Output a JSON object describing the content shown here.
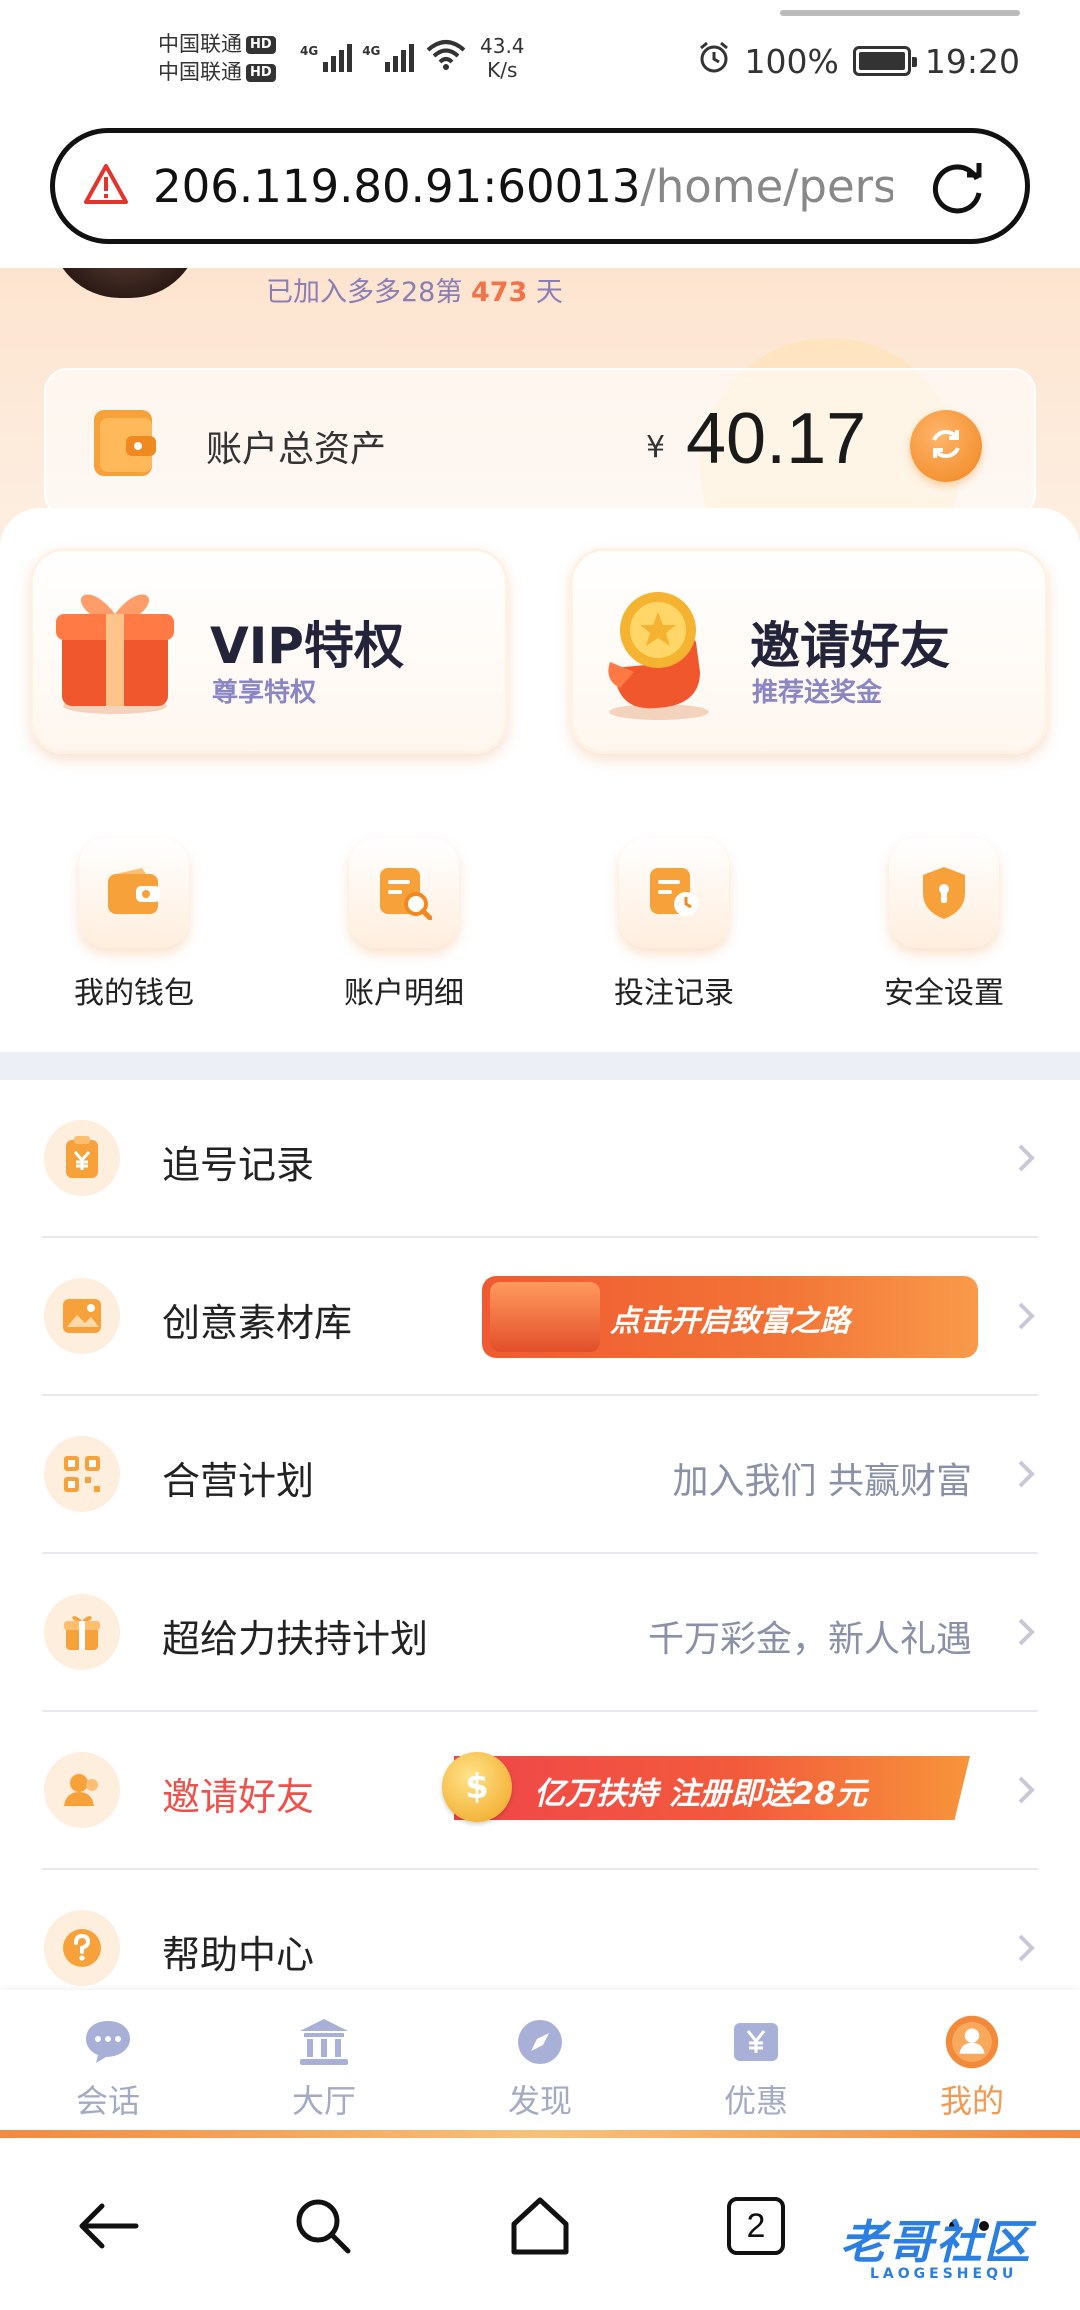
{
  "status_bar": {
    "carrier_1": "中国联通",
    "carrier_2": "中国联通",
    "hd_label": "HD",
    "network_1": "4G",
    "network_2": "4G",
    "speed_value": "43.4",
    "speed_unit": "K/s",
    "battery": "100%",
    "time": "19:20"
  },
  "url_bar": {
    "host": "206.119.80.91:60013",
    "path": "/home/perso"
  },
  "profile": {
    "join_prefix": "已加入多多28第",
    "join_days": "473",
    "join_suffix": "天"
  },
  "assets": {
    "label": "账户总资产",
    "currency": "¥",
    "value": "40.17"
  },
  "promos": [
    {
      "title": "VIP特权",
      "subtitle": "尊享特权"
    },
    {
      "title": "邀请好友",
      "subtitle": "推荐送奖金"
    }
  ],
  "quick_actions": [
    {
      "label": "我的钱包",
      "icon": "wallet-icon"
    },
    {
      "label": "账户明细",
      "icon": "account-detail-icon"
    },
    {
      "label": "投注记录",
      "icon": "bet-record-icon"
    },
    {
      "label": "安全设置",
      "icon": "shield-icon"
    }
  ],
  "menu": [
    {
      "label": "追号记录",
      "hint": "",
      "icon": "clipboard-yen-icon"
    },
    {
      "label": "创意素材库",
      "banner": "点击开启致富之路",
      "icon": "image-icon"
    },
    {
      "label": "合营计划",
      "hint": "加入我们 共赢财富",
      "icon": "qr-code-icon"
    },
    {
      "label": "超给力扶持计划",
      "hint": "千万彩金，新人礼遇",
      "icon": "gift-icon"
    },
    {
      "label": "邀请好友",
      "banner": "亿万扶持  注册即送28元",
      "icon": "user-icon"
    },
    {
      "label": "帮助中心",
      "hint": "",
      "icon": "help-icon"
    }
  ],
  "tabbar": [
    {
      "label": "会话",
      "icon": "chat-icon"
    },
    {
      "label": "大厅",
      "icon": "hall-icon"
    },
    {
      "label": "发现",
      "icon": "compass-icon"
    },
    {
      "label": "优惠",
      "icon": "coupon-icon"
    },
    {
      "label": "我的",
      "icon": "profile-icon",
      "active": true
    }
  ],
  "browser_nav": {
    "tabs_count": "2",
    "watermark": "老哥社区",
    "watermark_sub": "LAOGESHEQU"
  },
  "colors": {
    "accent": "#f39a52",
    "brand_orange": "#f0861f",
    "muted_purple": "#8a86c4",
    "danger_red": "#f0504a"
  }
}
